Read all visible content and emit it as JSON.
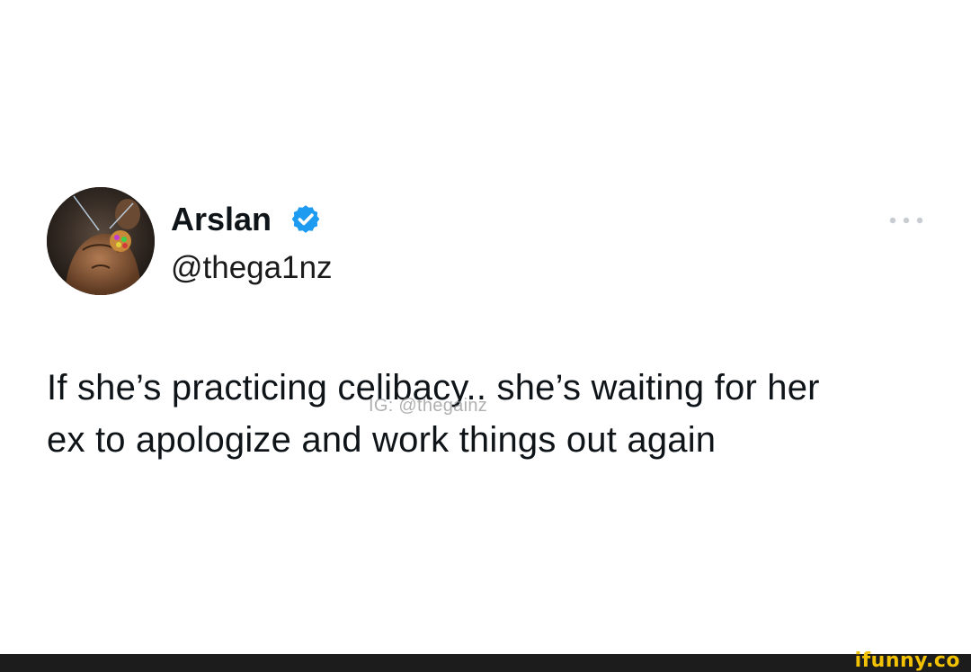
{
  "tweet": {
    "author": {
      "name": "Arslan",
      "handle": "@thega1nz",
      "verified": true,
      "avatar": "shirtless-man-avatar"
    },
    "more_icon": "more-horizontal-icon",
    "text_lines": [
      "If she’s practicing celibacy.. she’s waiting for her",
      "ex to apologize and work things out again"
    ]
  },
  "watermark": {
    "text": "IG: @thegainz"
  },
  "footer": {
    "logo": "ifunny.co"
  },
  "colors": {
    "verified_blue": "#1d9bf0",
    "text_primary": "#0f1419",
    "footer_bg": "#1c1c1c",
    "logo_yellow": "#f2c200"
  }
}
